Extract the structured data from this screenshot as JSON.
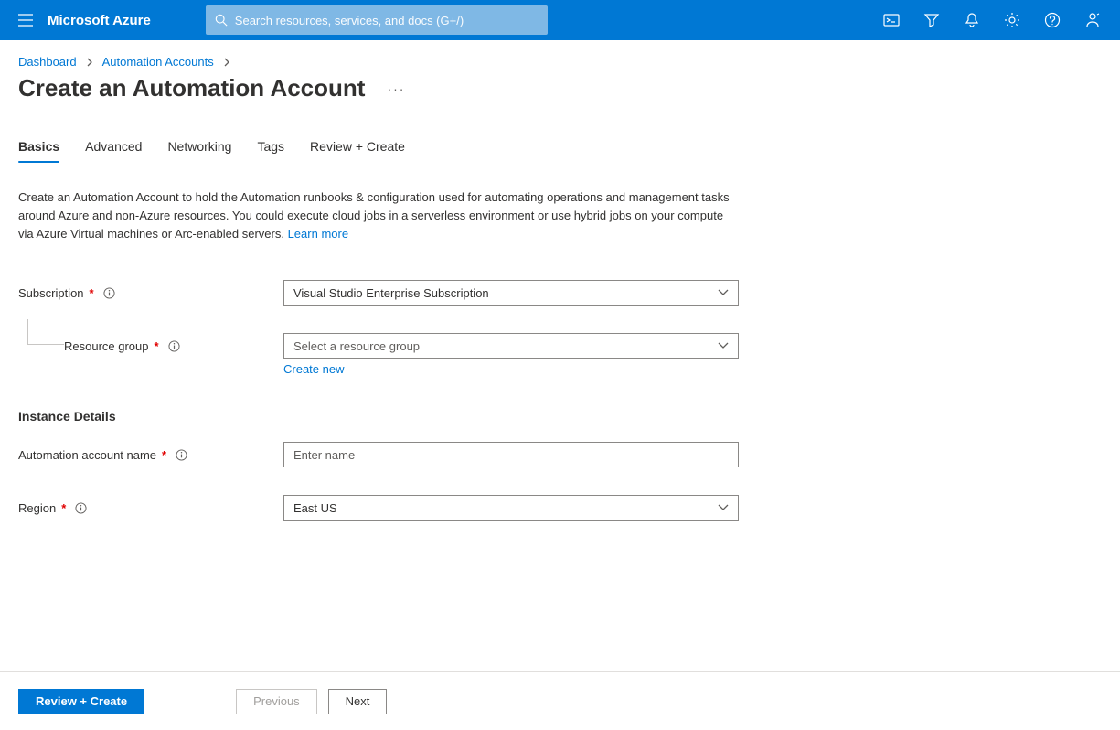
{
  "header": {
    "brand": "Microsoft Azure",
    "search_placeholder": "Search resources, services, and docs (G+/)"
  },
  "breadcrumb": {
    "items": [
      "Dashboard",
      "Automation Accounts"
    ]
  },
  "page": {
    "title": "Create an Automation Account"
  },
  "tabs": [
    "Basics",
    "Advanced",
    "Networking",
    "Tags",
    "Review + Create"
  ],
  "description": {
    "text": "Create an Automation Account to hold the Automation runbooks & configuration used for automating operations and management tasks around Azure and non-Azure resources. You could execute cloud jobs in a serverless environment or use hybrid jobs on your compute via Azure Virtual machines or Arc-enabled servers. ",
    "link_text": "Learn more"
  },
  "form": {
    "subscription": {
      "label": "Subscription",
      "value": "Visual Studio Enterprise Subscription"
    },
    "resource_group": {
      "label": "Resource group",
      "placeholder": "Select a resource group",
      "create_new": "Create new"
    },
    "instance_heading": "Instance Details",
    "account_name": {
      "label": "Automation account name",
      "placeholder": "Enter name"
    },
    "region": {
      "label": "Region",
      "value": "East US"
    }
  },
  "footer": {
    "review": "Review + Create",
    "previous": "Previous",
    "next": "Next"
  }
}
